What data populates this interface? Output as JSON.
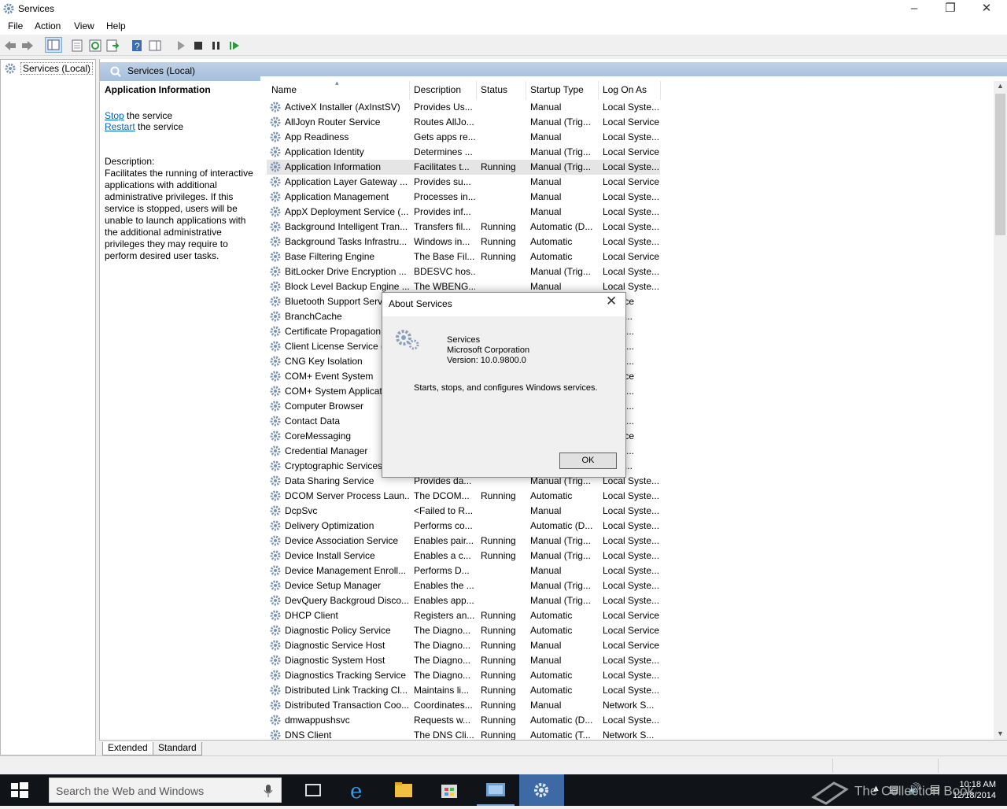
{
  "window": {
    "title": "Services",
    "minimize_icon": "minimize-icon",
    "maximize_icon": "maximize-icon",
    "close_icon": "close-icon"
  },
  "menu": [
    "File",
    "Action",
    "View",
    "Help"
  ],
  "tree": {
    "root_label": "Services (Local)"
  },
  "main_header": {
    "title": "Services (Local)"
  },
  "extended_pane": {
    "heading": "Application Information",
    "stop_link": "Stop",
    "stop_rest": " the service",
    "restart_link": "Restart",
    "restart_rest": " the service",
    "desc_label": "Description:",
    "desc_text": "Facilitates the running of interactive applications with additional administrative privileges.  If this service is stopped, users will be unable to launch applications with the additional administrative privileges they may require to perform desired user tasks."
  },
  "columns": [
    "Name",
    "Description",
    "Status",
    "Startup Type",
    "Log On As"
  ],
  "rows": [
    [
      "ActiveX Installer (AxInstSV)",
      "Provides Us...",
      "",
      "Manual",
      "Local Syste..."
    ],
    [
      "AllJoyn Router Service",
      "Routes AllJo...",
      "",
      "Manual (Trig...",
      "Local Service"
    ],
    [
      "App Readiness",
      "Gets apps re...",
      "",
      "Manual",
      "Local Syste..."
    ],
    [
      "Application Identity",
      "Determines ...",
      "",
      "Manual (Trig...",
      "Local Service"
    ],
    [
      "Application Information",
      "Facilitates t...",
      "Running",
      "Manual (Trig...",
      "Local Syste..."
    ],
    [
      "Application Layer Gateway ...",
      "Provides su...",
      "",
      "Manual",
      "Local Service"
    ],
    [
      "Application Management",
      "Processes in...",
      "",
      "Manual",
      "Local Syste..."
    ],
    [
      "AppX Deployment Service (...",
      "Provides inf...",
      "",
      "Manual",
      "Local Syste..."
    ],
    [
      "Background Intelligent Tran...",
      "Transfers fil...",
      "Running",
      "Automatic (D...",
      "Local Syste..."
    ],
    [
      "Background Tasks Infrastru...",
      "Windows in...",
      "Running",
      "Automatic",
      "Local Syste..."
    ],
    [
      "Base Filtering Engine",
      "The Base Fil...",
      "Running",
      "Automatic",
      "Local Service"
    ],
    [
      "BitLocker Drive Encryption ...",
      "BDESVC hos...",
      "",
      "Manual (Trig...",
      "Local Syste..."
    ],
    [
      "Block Level Backup Engine ...",
      "The WBENG...",
      "",
      "Manual",
      "Local Syste..."
    ],
    [
      "Bluetooth Support Servi",
      "",
      "",
      "",
      "Service"
    ],
    [
      "BranchCache",
      "",
      "",
      "",
      "ork S..."
    ],
    [
      "Certificate Propagation",
      "",
      "",
      "",
      "Syste..."
    ],
    [
      "Client License Service (C",
      "",
      "",
      "",
      "Syste..."
    ],
    [
      "CNG Key Isolation",
      "",
      "",
      "",
      "Syste..."
    ],
    [
      "COM+ Event System",
      "",
      "",
      "",
      "Service"
    ],
    [
      "COM+ System Applicat",
      "",
      "",
      "",
      "Syste..."
    ],
    [
      "Computer Browser",
      "",
      "",
      "",
      "Syste..."
    ],
    [
      "Contact Data",
      "",
      "",
      "",
      "Syste..."
    ],
    [
      "CoreMessaging",
      "",
      "",
      "",
      "Service"
    ],
    [
      "Credential Manager",
      "",
      "",
      "",
      "Syste..."
    ],
    [
      "Cryptographic Services",
      "",
      "",
      "",
      "ork S..."
    ],
    [
      "Data Sharing Service",
      "Provides da...",
      "",
      "Manual (Trig...",
      "Local Syste..."
    ],
    [
      "DCOM Server Process Laun...",
      "The DCOM...",
      "Running",
      "Automatic",
      "Local Syste..."
    ],
    [
      "DcpSvc",
      "<Failed to R...",
      "",
      "Manual",
      "Local Syste..."
    ],
    [
      "Delivery Optimization",
      "Performs co...",
      "",
      "Automatic (D...",
      "Local Syste..."
    ],
    [
      "Device Association Service",
      "Enables pair...",
      "Running",
      "Manual (Trig...",
      "Local Syste..."
    ],
    [
      "Device Install Service",
      "Enables a c...",
      "Running",
      "Manual (Trig...",
      "Local Syste..."
    ],
    [
      "Device Management Enroll...",
      "Performs D...",
      "",
      "Manual",
      "Local Syste..."
    ],
    [
      "Device Setup Manager",
      "Enables the ...",
      "",
      "Manual (Trig...",
      "Local Syste..."
    ],
    [
      "DevQuery Backgroud Disco...",
      "Enables app...",
      "",
      "Manual (Trig...",
      "Local Syste..."
    ],
    [
      "DHCP Client",
      "Registers an...",
      "Running",
      "Automatic",
      "Local Service"
    ],
    [
      "Diagnostic Policy Service",
      "The Diagno...",
      "Running",
      "Automatic",
      "Local Service"
    ],
    [
      "Diagnostic Service Host",
      "The Diagno...",
      "Running",
      "Manual",
      "Local Service"
    ],
    [
      "Diagnostic System Host",
      "The Diagno...",
      "Running",
      "Manual",
      "Local Syste..."
    ],
    [
      "Diagnostics Tracking Service",
      "The Diagno...",
      "Running",
      "Automatic",
      "Local Syste..."
    ],
    [
      "Distributed Link Tracking Cl...",
      "Maintains li...",
      "Running",
      "Automatic",
      "Local Syste..."
    ],
    [
      "Distributed Transaction Coo...",
      "Coordinates...",
      "Running",
      "Manual",
      "Network S..."
    ],
    [
      "dmwappushsvc",
      "Requests w...",
      "Running",
      "Automatic (D...",
      "Local Syste..."
    ],
    [
      "DNS Client",
      "The DNS Cli...",
      "Running",
      "Automatic (T...",
      "Network S..."
    ]
  ],
  "selected_row": 4,
  "tabs": [
    "Extended",
    "Standard"
  ],
  "taskbar": {
    "search_placeholder": "Search the Web and Windows",
    "time": "10:18 AM",
    "date": "12/18/2014",
    "watermark": "The Collection Book"
  },
  "dialog": {
    "title": "About Services",
    "app_name": "Services",
    "company": "Microsoft Corporation",
    "version": "Version: 10.0.9800.0",
    "description": "Starts, stops, and configures Windows services.",
    "ok_label": "OK"
  },
  "colors": {
    "accent": "#0078d7",
    "header_blue": "#a6bfdc",
    "taskbar": "#101418",
    "link": "#0066cc"
  }
}
